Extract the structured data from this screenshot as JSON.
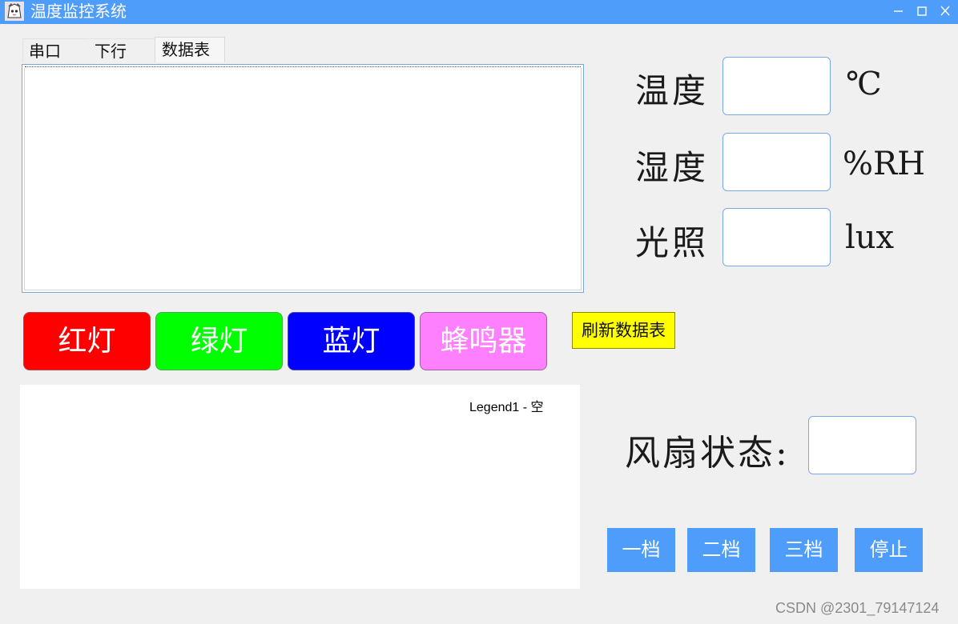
{
  "window": {
    "title": "温度监控系统",
    "controls": {
      "minimize_icon": "minimize-icon",
      "maximize_icon": "maximize-icon",
      "close_icon": "close-icon"
    },
    "titlebar_color": "#4f9dfb"
  },
  "tabs": [
    {
      "label": "串口"
    },
    {
      "label": "下行"
    },
    {
      "label": "数据表",
      "selected": true
    }
  ],
  "sensors": {
    "temperature": {
      "label": "温度",
      "value": "",
      "unit": "℃"
    },
    "humidity": {
      "label": "湿度",
      "value": "",
      "unit": "%RH"
    },
    "light": {
      "label": "光照",
      "value": "",
      "unit": "lux"
    }
  },
  "light_buttons": {
    "red": {
      "label": "红灯",
      "color": "#ff0000"
    },
    "green": {
      "label": "绿灯",
      "color": "#00ff00"
    },
    "blue": {
      "label": "蓝灯",
      "color": "#0000ff"
    },
    "buzzer": {
      "label": "蜂鸣器",
      "color": "#ff80ff"
    }
  },
  "refresh_button": {
    "label": "刷新数据表",
    "color": "#ffff00"
  },
  "chart_data": {
    "type": "line",
    "legend": [
      "Legend1 - 空"
    ],
    "legend_position": "top-right",
    "series": []
  },
  "fan": {
    "label": "风扇状态:",
    "value": "",
    "buttons": {
      "speed1": "一档",
      "speed2": "二档",
      "speed3": "三档",
      "stop": "停止"
    }
  },
  "watermark": "CSDN @2301_79147124"
}
